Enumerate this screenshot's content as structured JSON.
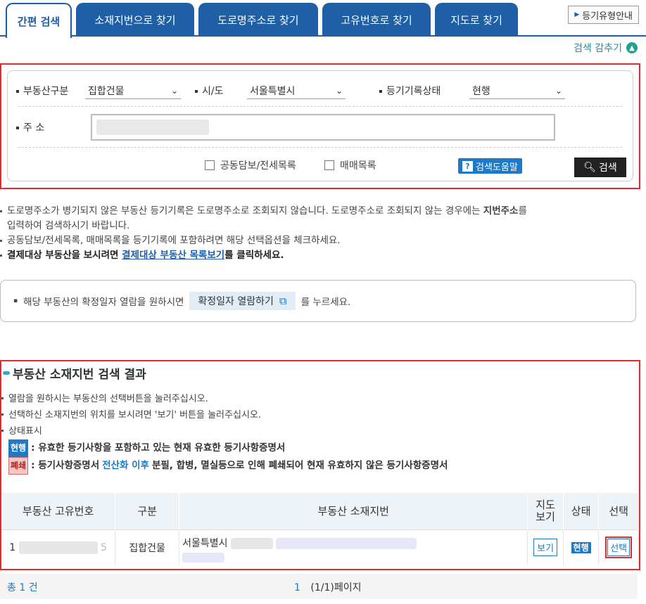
{
  "tabs": [
    {
      "label": "간편 검색"
    },
    {
      "label": "소재지번으로 찾기"
    },
    {
      "label": "도로명주소로 찾기"
    },
    {
      "label": "고유번호로 찾기"
    },
    {
      "label": "지도로 찾기"
    }
  ],
  "help_button": "등기유형안내",
  "collapse_label": "검색 감추기",
  "search": {
    "type_label": "부동산구분",
    "type_value": "집합건물",
    "city_label": "시/도",
    "city_value": "서울특별시",
    "status_label": "등기기록상태",
    "status_value": "현행",
    "address_label": "주 소",
    "check1": "공동담보/전세목록",
    "check2": "매매목록",
    "help_label": "검색도움말",
    "search_label": "검색"
  },
  "notes": {
    "n1a": "도로명주소가 병기되지 않은 부동산 등기기록은 도로명주소로 조회되지 않습니다. 도로명주소로 조회되지 않는 경우에는 ",
    "n1b": "지번주소",
    "n1c": "를",
    "n1d": "입력하여 검색하시기 바랍니다.",
    "n2": "공동담보/전세목록, 매매목록을 등기기록에 포함하려면 해당 선택옵션을 체크하세요.",
    "n3a": "결제대상 부동산을 보시려면 ",
    "n3b": "결제대상 부동산 목록보기",
    "n3c": "를 클릭하세요."
  },
  "confirm": {
    "pre": "해당 부동산의 확정일자 열람을 원하시면",
    "button": "확정일자 열람하기",
    "post": "를 누르세요."
  },
  "results": {
    "title": "부동산 소재지번 검색 결과",
    "note1": "열람을 원하시는 부동산의 선택버튼을 눌러주십시오.",
    "note2": "선택하신 소재지번의 위치를 보시려면 '보기' 버튼을 눌러주십시오.",
    "note3": "상태표시",
    "badge_current": "현행",
    "status_current_desc": ": 유효한 등기사항을 포함하고 있는 현재 유효한 등기사항증명서",
    "badge_closed": "폐쇄",
    "status_closed_a": ": 등기사항증명서 ",
    "status_closed_b": "전산화 이후",
    "status_closed_c": " 분필, 합병, 멸실등으로 인해 폐쇄되어 현재 유효하지 않은 등기사항증명서",
    "headers": {
      "id": "부동산 고유번호",
      "type": "구분",
      "address": "부동산 소재지번",
      "map": "지도 보기",
      "status": "상태",
      "select": "선택"
    },
    "row": {
      "id_start": "1",
      "id_end": "5",
      "type": "집합건물",
      "address": "서울특별시",
      "view": "보기",
      "status": "현행",
      "select": "선택"
    }
  },
  "footer": {
    "total": "총 1 건",
    "page": "1",
    "page_info": "(1/1)페이지"
  }
}
